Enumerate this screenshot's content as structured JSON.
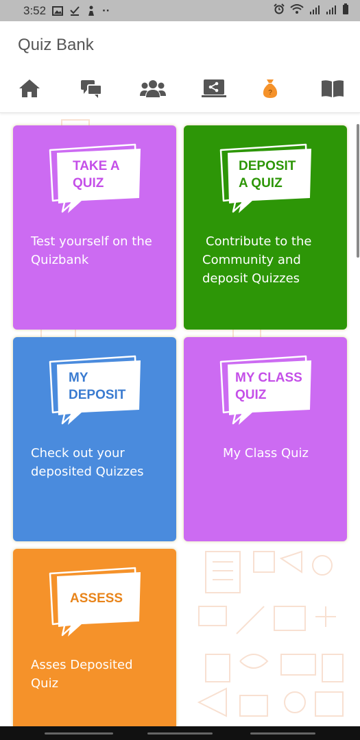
{
  "status_bar": {
    "time": "3:52",
    "dots": "··",
    "left_icons": [
      "image-icon",
      "checkmark-download-icon",
      "person-run-icon"
    ],
    "right_icons": [
      "alarm-icon",
      "wifi-icon",
      "signal-icon",
      "signal-icon",
      "battery-icon"
    ]
  },
  "app_bar": {
    "title": "Quiz Bank"
  },
  "nav": {
    "tabs": [
      {
        "name": "home",
        "icon": "home-icon",
        "active": false
      },
      {
        "name": "chat",
        "icon": "chat-bubbles-icon",
        "active": false
      },
      {
        "name": "groups",
        "icon": "group-icon",
        "active": false
      },
      {
        "name": "share",
        "icon": "screen-share-icon",
        "active": false
      },
      {
        "name": "quiz-bank",
        "icon": "money-bag-icon",
        "active": true
      },
      {
        "name": "library",
        "icon": "open-book-icon",
        "active": false
      }
    ],
    "active_color": "#f5922a",
    "inactive_color": "#555555"
  },
  "cards": [
    {
      "key": "take-quiz",
      "bubble_line1": "TAKE A",
      "bubble_line2": "QUIZ",
      "desc_line1": "Test yourself on the",
      "desc_line2": "Quizbank",
      "desc_line3": "",
      "color": "#cc6bf2",
      "text_color": "#c44fe8"
    },
    {
      "key": "deposit-quiz",
      "bubble_line1": "DEPOSIT",
      "bubble_line2": "A QUIZ",
      "desc_line1": "Contribute to the",
      "desc_line2": "Community and",
      "desc_line3": "deposit  Quizzes",
      "color": "#2d9607",
      "text_color": "#2d9607"
    },
    {
      "key": "my-deposit",
      "bubble_line1": "MY",
      "bubble_line2": "DEPOSIT",
      "desc_line1": "Check out your",
      "desc_line2": "deposited Quizzes",
      "desc_line3": "",
      "color": "#4a8bdd",
      "text_color": "#3a7bd0"
    },
    {
      "key": "my-class-quiz",
      "bubble_line1": "MY CLASS",
      "bubble_line2": "QUIZ",
      "desc_line1": "My Class Quiz",
      "desc_line2": "",
      "desc_line3": "",
      "color": "#cc6bf2",
      "text_color": "#c44fe8"
    },
    {
      "key": "assess",
      "bubble_line1": "ASSESS",
      "bubble_line2": "",
      "desc_line1": "Asses Deposited",
      "desc_line2": "Quiz",
      "desc_line3": "",
      "color": "#f5922a",
      "text_color": "#e8841a"
    }
  ]
}
